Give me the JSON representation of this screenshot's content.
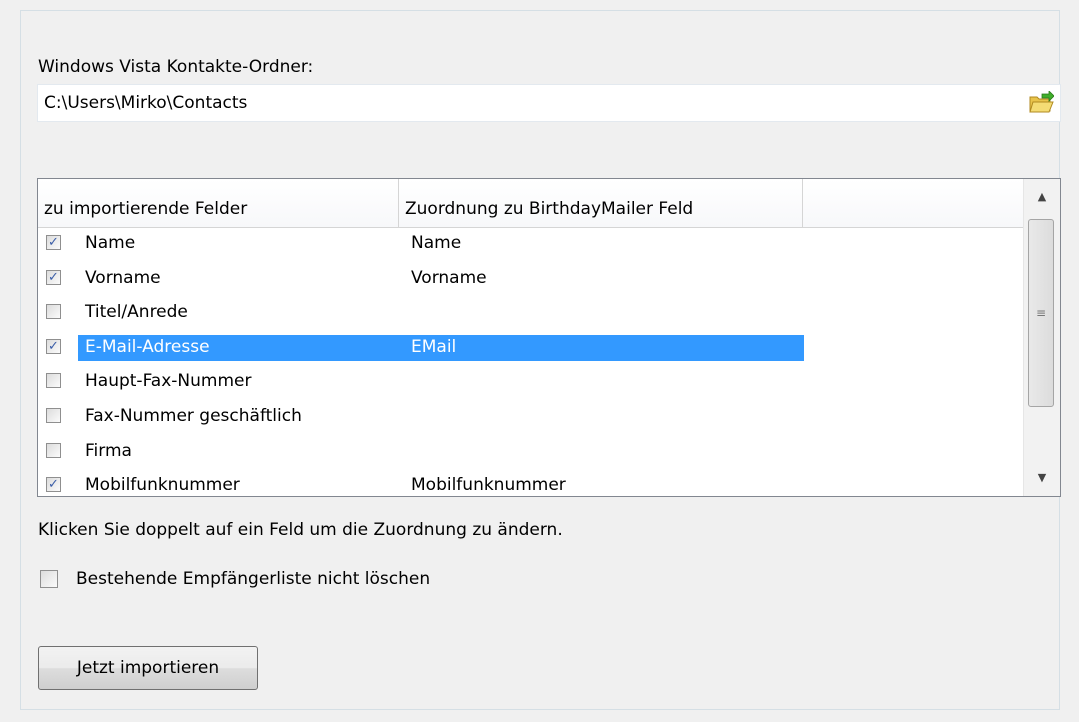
{
  "folder": {
    "label": "Windows Vista Kontakte-Ordner:",
    "path": "C:\\Users\\Mirko\\Contacts",
    "browse_icon": "open-folder-icon"
  },
  "list": {
    "columns": [
      "zu importierende Felder",
      "Zuordnung zu BirthdayMailer Feld",
      ""
    ],
    "rows": [
      {
        "checked": true,
        "field": "Name",
        "mapping": "Name",
        "selected": false
      },
      {
        "checked": true,
        "field": "Vorname",
        "mapping": "Vorname",
        "selected": false
      },
      {
        "checked": false,
        "field": "Titel/Anrede",
        "mapping": "",
        "selected": false
      },
      {
        "checked": true,
        "field": "E-Mail-Adresse",
        "mapping": "EMail",
        "selected": true
      },
      {
        "checked": false,
        "field": "Haupt-Fax-Nummer",
        "mapping": "",
        "selected": false
      },
      {
        "checked": false,
        "field": "Fax-Nummer geschäftlich",
        "mapping": "",
        "selected": false
      },
      {
        "checked": false,
        "field": "Firma",
        "mapping": "",
        "selected": false
      },
      {
        "checked": true,
        "field": "Mobilfunknummer",
        "mapping": "Mobilfunknummer",
        "selected": false
      }
    ],
    "selection_color": "#3399ff"
  },
  "hint": "Klicken Sie doppelt auf ein Feld um die Zuordnung zu ändern.",
  "keep_list": {
    "label": "Bestehende Empfängerliste nicht löschen",
    "checked": false
  },
  "import_button": "Jetzt importieren"
}
